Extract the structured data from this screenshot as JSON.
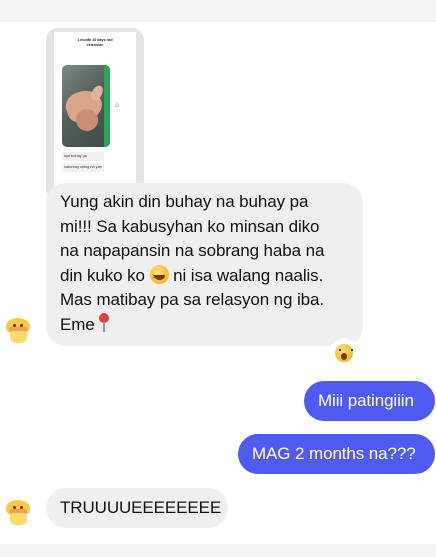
{
  "chat": {
    "attachment": {
      "caption_line1": "1 month 10 days nail",
      "caption_line2": "extension",
      "msg1": "aye buhay pa",
      "msg2": "natuntag untog na yan"
    },
    "messages": [
      {
        "sender": "them",
        "lines": [
          "Yung akin din buhay na buhay pa",
          "mi!!! Sa kabusyhan ko minsan diko",
          "na napapansin na sobrang haba na",
          "din kuko ko",
          "ni isa walang naalis.",
          "Mas matibay pa sa relasyon ng iba.",
          "Eme"
        ],
        "reaction": "surprised-face-emoji"
      },
      {
        "sender": "me",
        "text": "Miii patingiiin"
      },
      {
        "sender": "me",
        "text": "MAG 2 months na???"
      },
      {
        "sender": "them",
        "text": "TRUUUUEEEEEEEE"
      }
    ]
  },
  "icons": {
    "grin": "laughing-squint-emoji",
    "pin": "round-pushpin-emoji",
    "avatar": "yellow-sticker-avatar"
  },
  "colors": {
    "incoming_bubble": "#efeff0",
    "outgoing_bubble": "#4f5bf0",
    "background": "#ffffff"
  }
}
